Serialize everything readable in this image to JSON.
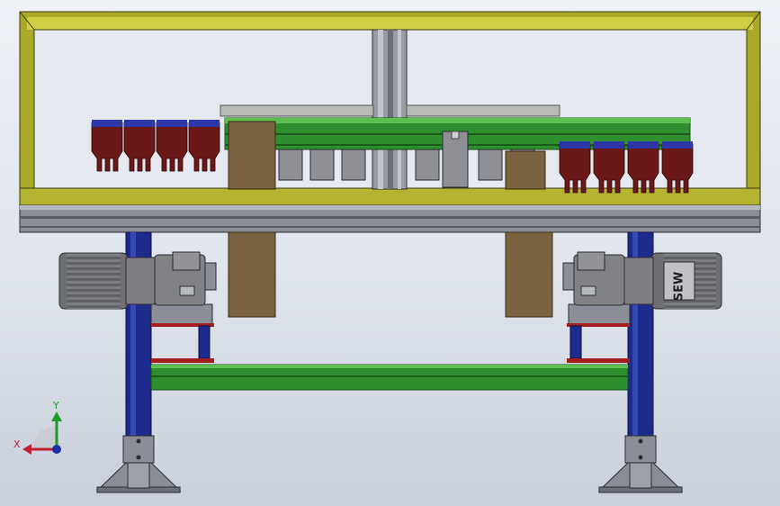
{
  "triad": {
    "x_label": "X",
    "y_label": "Y"
  },
  "motors": {
    "right_brand": "SEW"
  },
  "colors": {
    "frame_yellow": "#a9a829",
    "frame_yellow_dark": "#6f6d12",
    "table_gray": "#8b8e96",
    "column_blue": "#1c2b8c",
    "conveyor_green": "#2f8f2f",
    "belt_brown": "#7b6340",
    "motor_gray": "#6d6f72",
    "bracket_red": "#a31f1f",
    "gripper_maroon": "#6b1818",
    "axis_x": "#c0202f",
    "axis_y": "#1e9a2a",
    "axis_z": "#1d2fa5"
  },
  "icons": {
    "triad": "coordinate-triad-icon"
  }
}
